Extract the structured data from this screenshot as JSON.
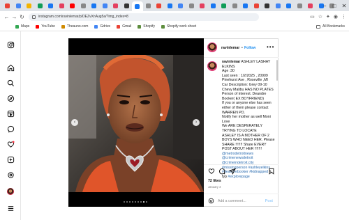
{
  "browser": {
    "url": "instagram.com/ravinlemar/p/DEZvXnAug5a/?img_index=8",
    "tab_badges": [
      "",
      "",
      "",
      "",
      "",
      "",
      "",
      "",
      "",
      "",
      "",
      "",
      "",
      "",
      "",
      "",
      "",
      "",
      "",
      "",
      "",
      "",
      "",
      "",
      "",
      "",
      "",
      "",
      "",
      "",
      ""
    ],
    "bookmarks": [
      {
        "label": "Maps",
        "color": "#34a853"
      },
      {
        "label": "YouTube",
        "color": "#ff0000"
      },
      {
        "label": "Theauno.com",
        "color": "#d08a00"
      },
      {
        "label": "Gdrive",
        "color": "#4285f4"
      },
      {
        "label": "Gmail",
        "color": "#ea4335"
      },
      {
        "label": "Shopify",
        "color": "#5e8e3e"
      },
      {
        "label": "Shopify work sheet",
        "color": "#5e8e3e"
      }
    ],
    "all_bookmarks": "All Bookmarks"
  },
  "post": {
    "username": "ravinlemar",
    "separator": "•",
    "follow_label": "Follow",
    "more_icon": "•••",
    "caption_user": "ravinlemar",
    "caption_lines": [
      "ASHLEY LASHAY ELKINS",
      "Age :30",
      "Last seen : 1/2/2025 , 20909 Pinehurst Ave , Roseville ,MI",
      "Car Description: Grey 09-10 Chevy Malibu HAS NO PLATES",
      "Person of interest. Deandre Booker( EX BOYFRIEND)",
      "If you or anyone else has seen either of them please contact WARREN PD.",
      "Notify her mother as well Moni Love",
      "We ARE DESPERATELY TRYING TO LOCATE",
      "ASHLEY IS A MOTHER OF 2 BOYS WHO NEED HER. Please SHARE !!!!!!! Share EVERY POST ABOUT HER !!!!!!!"
    ],
    "hashtags": "@metrodetroitnews @crimenewsdetroit @crimeindetroit.city #missingperson #ashleyelkins #deandrebooker #kidnapped",
    "hashtag_tail": " # fyp ",
    "hashtag_last": "#explorepage",
    "likes": "72 likes",
    "date": "January 4",
    "comment_placeholder": "Add a comment...",
    "post_button": "Post",
    "carousel": {
      "count": 9,
      "active_index": 7
    }
  },
  "colors": {
    "accent": "#1a8cf0",
    "link": "#2b6cb0",
    "notification": "#ff3040"
  }
}
